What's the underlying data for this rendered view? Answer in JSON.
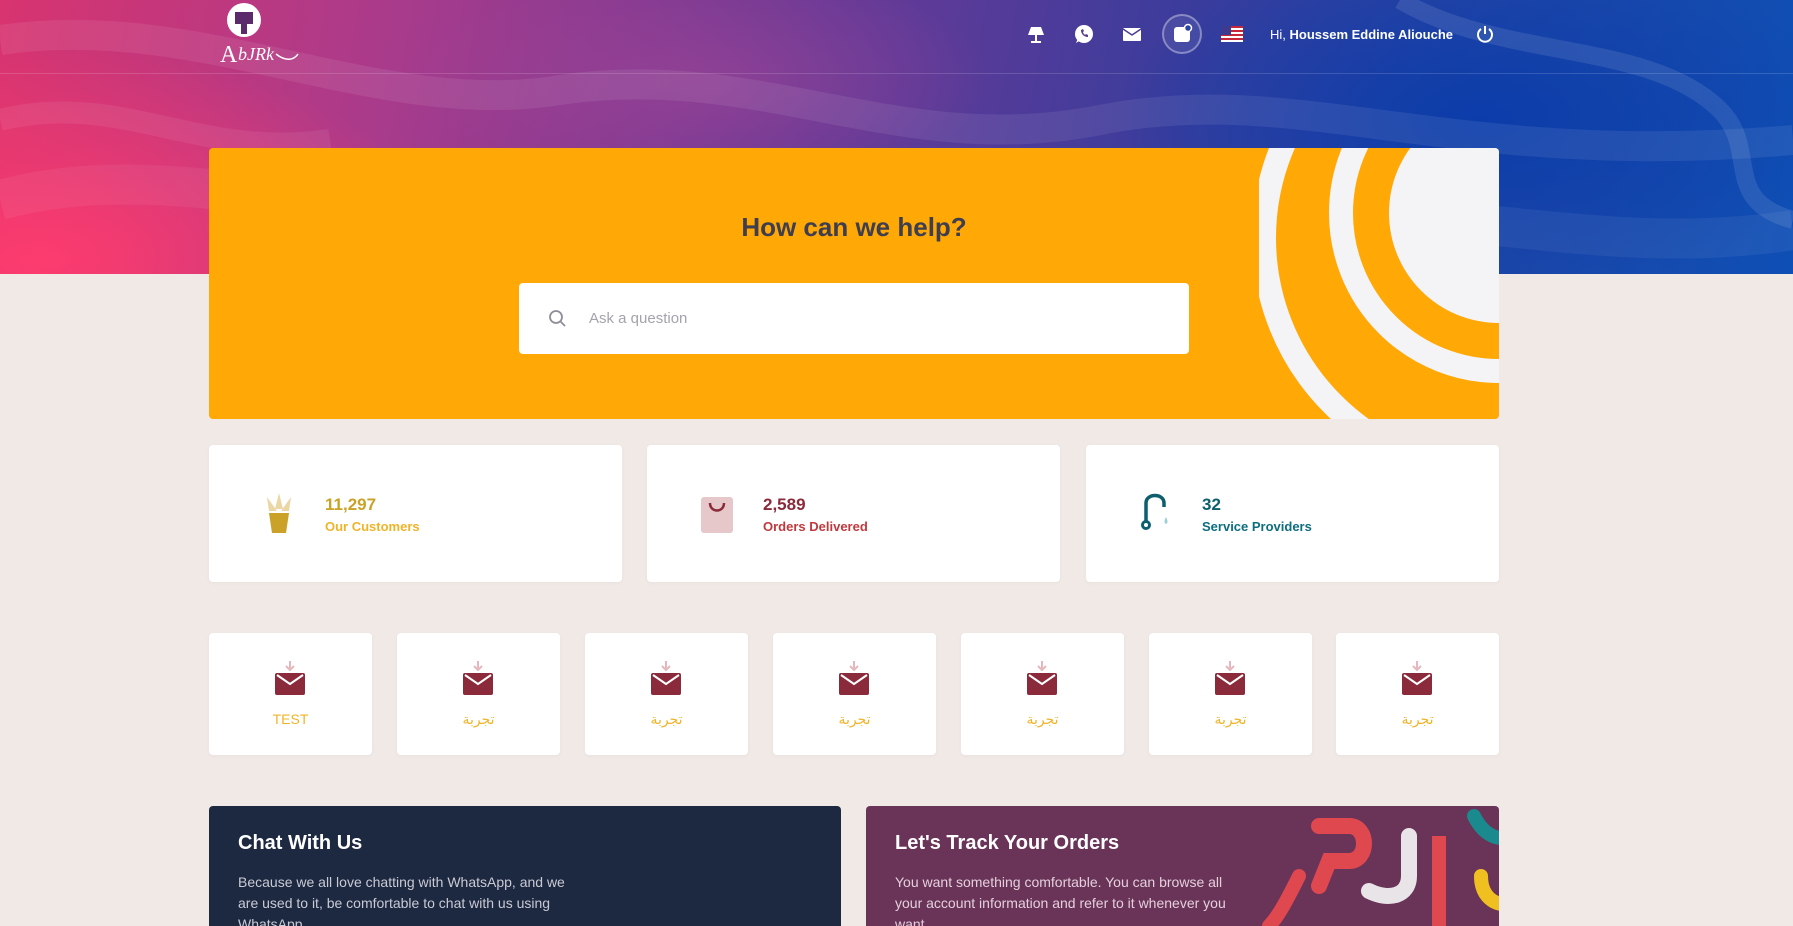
{
  "header": {
    "logo_alt": "ABJRK",
    "greeting_prefix": "Hi, ",
    "user_name": "Houssem Eddine Aliouche",
    "icons": [
      "lamp-icon",
      "whatsapp-icon",
      "mail-icon",
      "notification-icon",
      "us-flag-icon",
      "power-icon"
    ]
  },
  "help": {
    "title": "How can we help?",
    "search_placeholder": "Ask a question"
  },
  "stats": [
    {
      "value": "11,297",
      "label": "Our Customers",
      "color": "#c9a227"
    },
    {
      "value": "2,589",
      "label": "Orders Delivered",
      "color": "#8b2a3a"
    },
    {
      "value": "32",
      "label": "Service Providers",
      "color": "#0d5f6e"
    }
  ],
  "categories": [
    {
      "label": "TEST"
    },
    {
      "label": "تجربة"
    },
    {
      "label": "تجربة"
    },
    {
      "label": "تجربة"
    },
    {
      "label": "تجربة"
    },
    {
      "label": "تجربة"
    },
    {
      "label": "تجربة"
    }
  ],
  "promos": {
    "chat": {
      "title": "Chat With Us",
      "text": "Because we all love chatting with WhatsApp, and we are used to it, be comfortable to chat with us using WhatsApp."
    },
    "track": {
      "title": "Let's Track Your Orders",
      "text": "You want something comfortable. You can browse all your account information and refer to it whenever you want."
    }
  },
  "colors": {
    "banner": "#ffa806",
    "category_icon": "#8b2a3a",
    "category_label": "#f0b429"
  }
}
